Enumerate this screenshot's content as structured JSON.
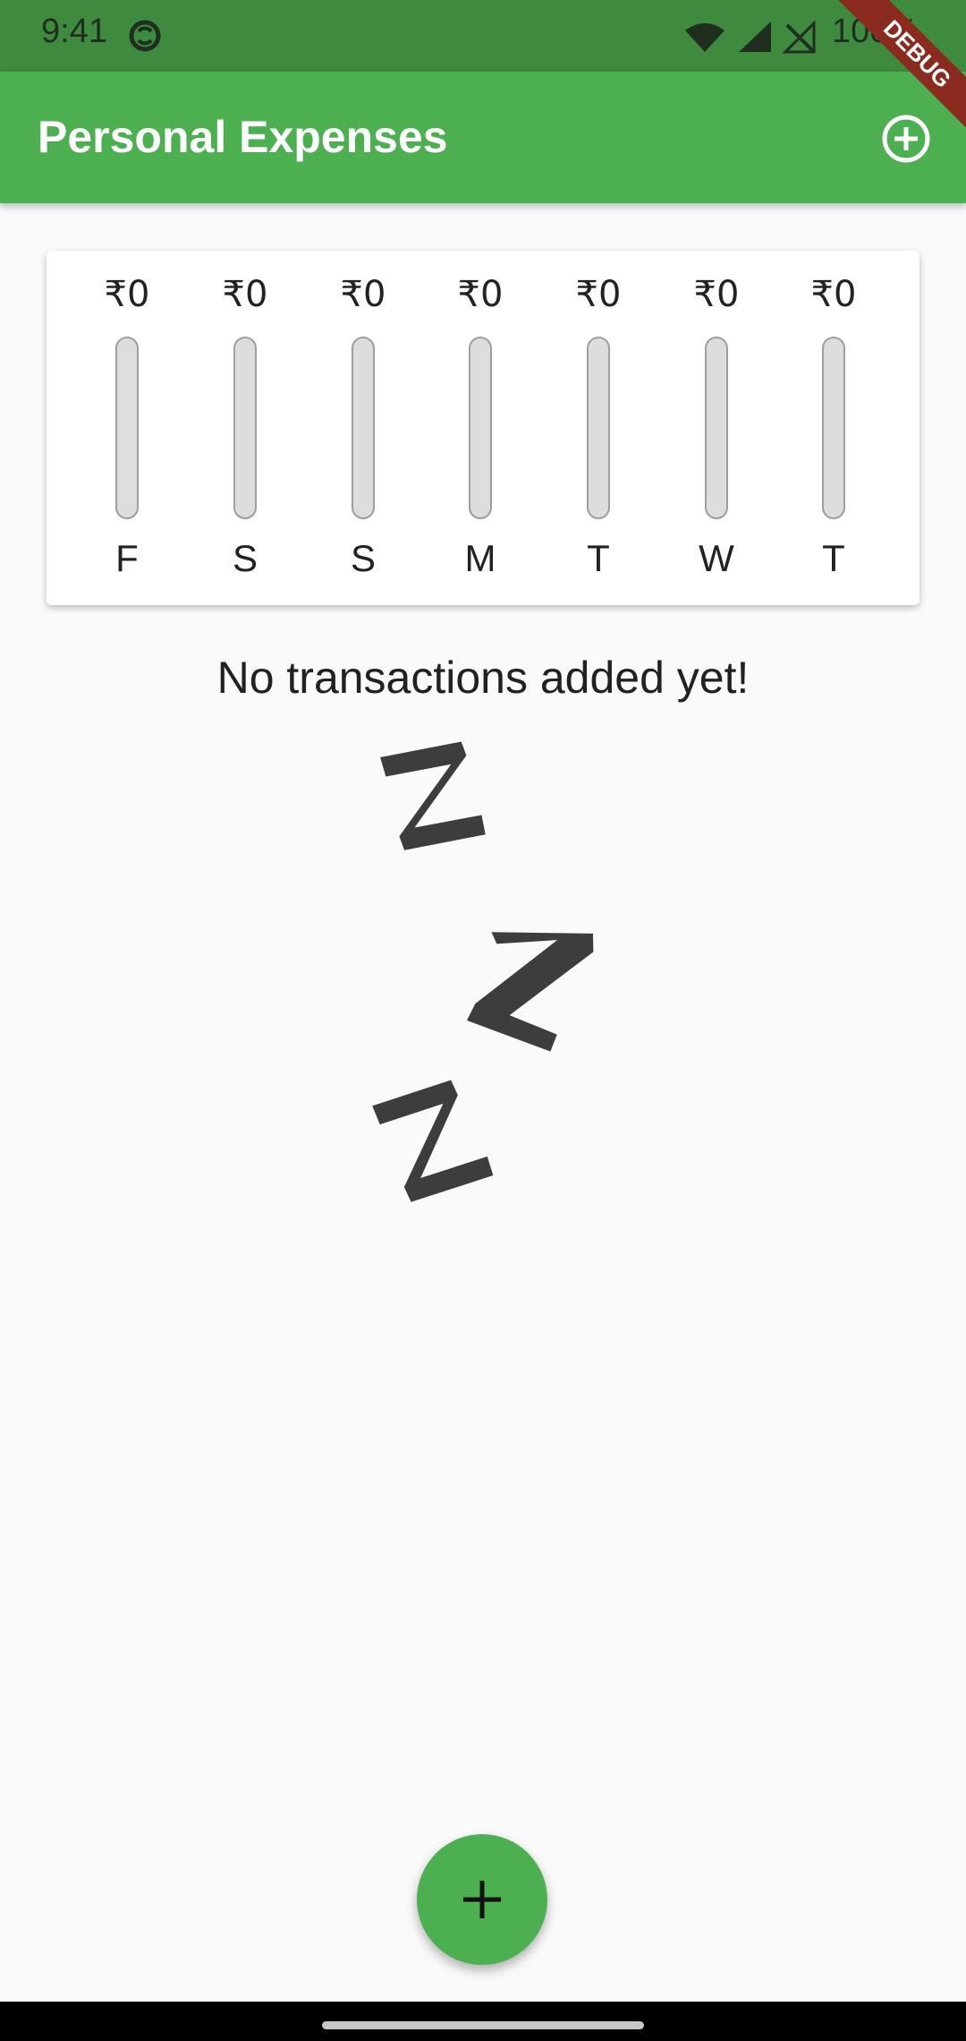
{
  "status_bar": {
    "time": "9:41",
    "battery": "100%",
    "icons": [
      "sync-icon",
      "wifi-icon",
      "signal-icon",
      "no-sim-icon"
    ],
    "background": "#3e8a3f"
  },
  "app_bar": {
    "title": "Personal Expenses",
    "action_icon": "add-circle-outline-icon",
    "background": "#4caf50"
  },
  "debug_banner": {
    "label": "DEBUG",
    "color": "#8b2a1e"
  },
  "chart_data": {
    "type": "bar",
    "categories": [
      "F",
      "S",
      "S",
      "M",
      "T",
      "W",
      "T"
    ],
    "values": [
      0,
      0,
      0,
      0,
      0,
      0,
      0
    ],
    "value_labels": [
      "₹0",
      "₹0",
      "₹0",
      "₹0",
      "₹0",
      "₹0",
      "₹0"
    ],
    "fill_fraction": [
      0,
      0,
      0,
      0,
      0,
      0,
      0
    ],
    "track_color": "#dddddd",
    "fill_color": "#4caf50"
  },
  "empty_state": {
    "message": "No transactions added yet!",
    "illustration": "sleeping-zzz-image"
  },
  "fab": {
    "icon": "plus-icon",
    "color": "#4caf50"
  }
}
